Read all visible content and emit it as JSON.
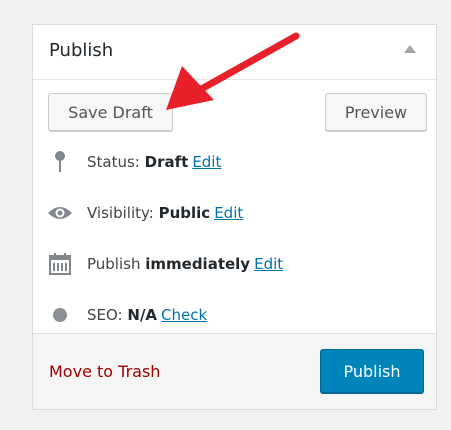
{
  "box": {
    "title": "Publish",
    "toggle_icon": "collapse-triangle-icon"
  },
  "buttons": {
    "save_draft": "Save Draft",
    "preview": "Preview",
    "publish": "Publish"
  },
  "status": {
    "icon": "pin-icon",
    "label": "Status:",
    "value": "Draft",
    "action": "Edit"
  },
  "visibility": {
    "icon": "eye-icon",
    "label": "Visibility:",
    "value": "Public",
    "action": "Edit"
  },
  "schedule": {
    "icon": "calendar-icon",
    "label": "Publish",
    "value": "immediately",
    "action": "Edit"
  },
  "seo": {
    "icon": "gray-dot-icon",
    "label": "SEO:",
    "value": "N/A",
    "action": "Check"
  },
  "footer": {
    "trash": "Move to Trash"
  },
  "colors": {
    "link": "#0073aa",
    "trash": "#a00000",
    "primary": "#0085ba",
    "arrow": "#e8202a"
  }
}
